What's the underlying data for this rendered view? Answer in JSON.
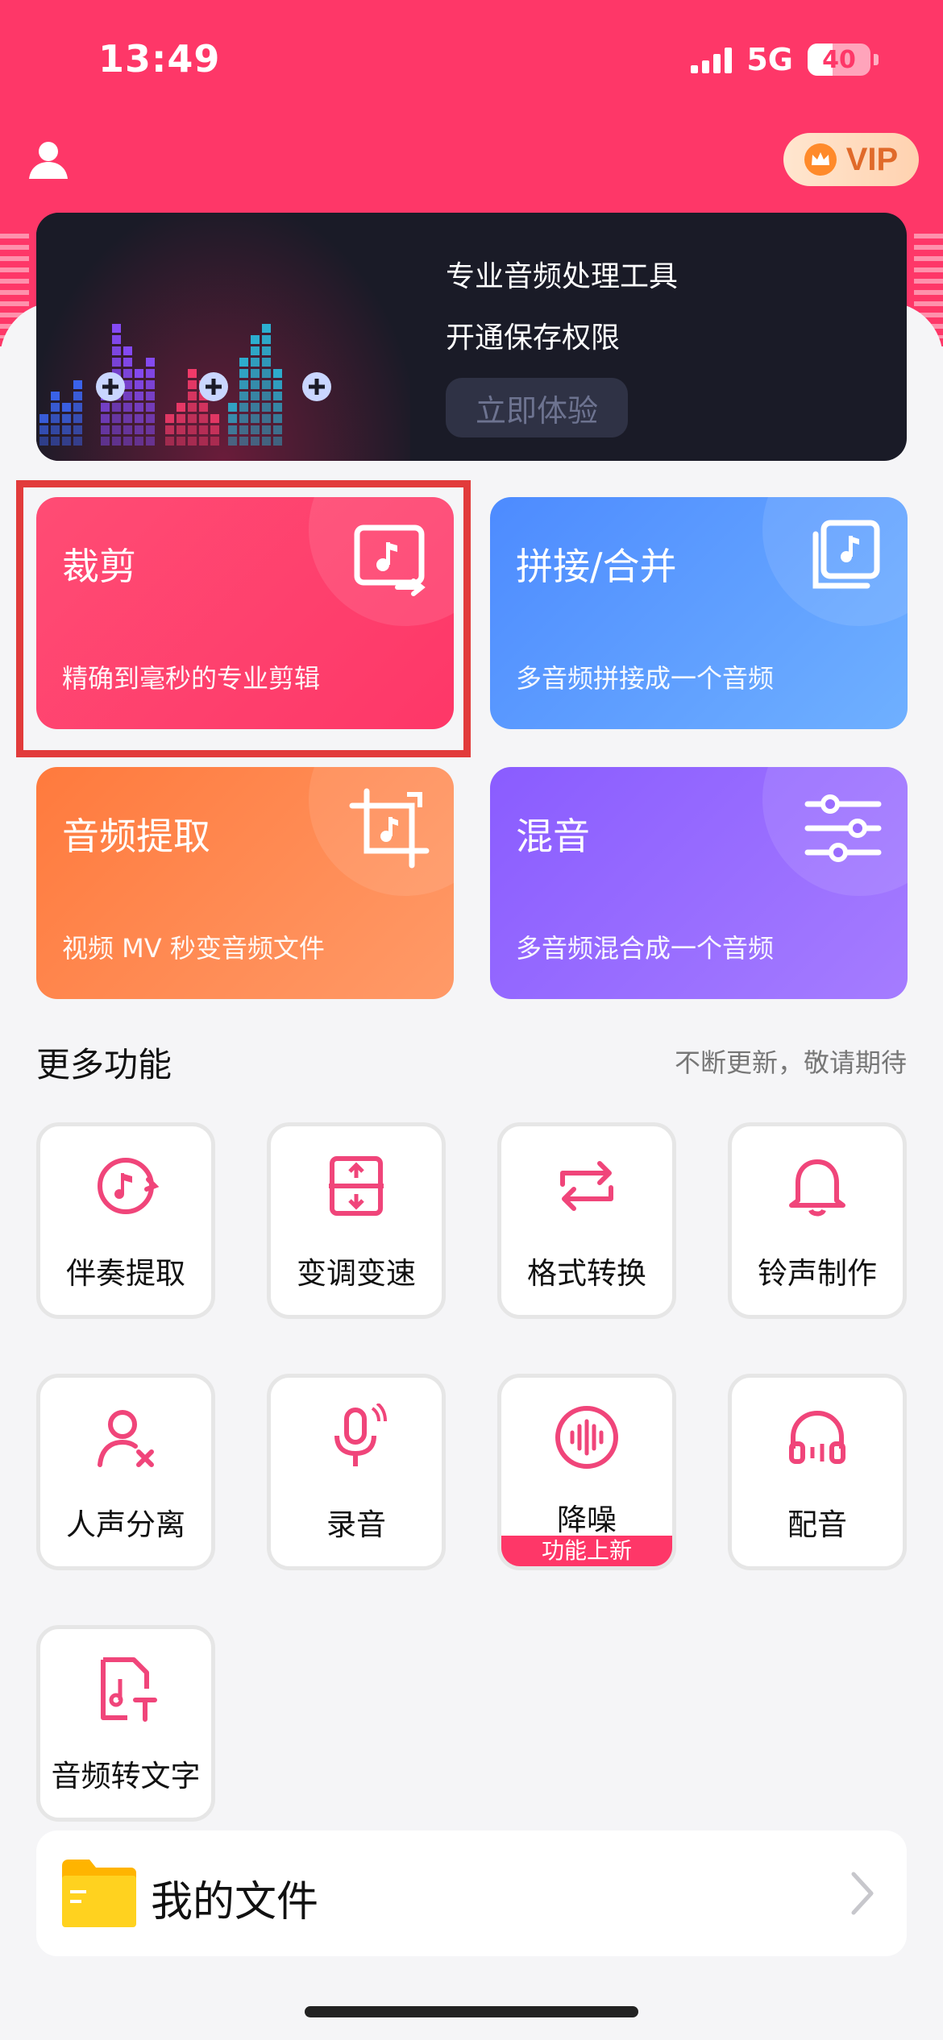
{
  "status_bar": {
    "time": "13:49",
    "network": "5G",
    "battery": "40",
    "battery_level": 0.4
  },
  "header": {
    "vip_label": "VIP"
  },
  "banner": {
    "title": "专业音频处理工具",
    "subtitle": "开通保存权限",
    "cta": "立即体验"
  },
  "cards": [
    {
      "title": "裁剪",
      "subtitle": "精确到毫秒的专业剪辑"
    },
    {
      "title": "拼接/合并",
      "subtitle": "多音频拼接成一个音频"
    },
    {
      "title": "音频提取",
      "subtitle": "视频 MV 秒变音频文件"
    },
    {
      "title": "混音",
      "subtitle": "多音频混合成一个音频"
    }
  ],
  "more": {
    "title": "更多功能",
    "hint": "不断更新，敬请期待",
    "tools": [
      {
        "label": "伴奏提取"
      },
      {
        "label": "变调变速"
      },
      {
        "label": "格式转换"
      },
      {
        "label": "铃声制作"
      },
      {
        "label": "人声分离"
      },
      {
        "label": "录音"
      },
      {
        "label": "降噪",
        "badge": "功能上新"
      },
      {
        "label": "配音"
      },
      {
        "label": "音频转文字"
      }
    ]
  },
  "files": {
    "label": "我的文件"
  },
  "colors": {
    "brand": "#fe3768",
    "cut": "#fe3768",
    "join": "#4d8bff",
    "extract": "#ff7a3d",
    "mix": "#8a5cff",
    "highlight": "#e23b3b"
  }
}
